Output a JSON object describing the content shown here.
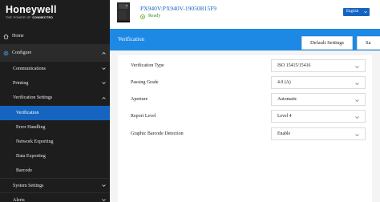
{
  "brand": {
    "name": "Honeywell",
    "tagline_prefix": "THE POWER OF",
    "tagline_bold": "CONNECTED"
  },
  "header": {
    "printer_name": "PX940V:PX940V-19050B15F9",
    "status": "Ready",
    "language": "English"
  },
  "sidebar": {
    "home": "Home",
    "configure": "Configure",
    "items": [
      {
        "label": "Communications"
      },
      {
        "label": "Printing"
      },
      {
        "label": "Verification Settings"
      },
      {
        "label": "Verification"
      },
      {
        "label": "Error Handling"
      },
      {
        "label": "Network Exporting"
      },
      {
        "label": "Data Exporting"
      },
      {
        "label": "Barcode"
      },
      {
        "label": "System Settings"
      },
      {
        "label": "Alerts"
      }
    ]
  },
  "page": {
    "title": "Verification",
    "default_button": "Default Settings",
    "save_button": "Sa"
  },
  "settings": [
    {
      "label": "Verification Type",
      "value": "ISO 15415/15416"
    },
    {
      "label": "Passing Grade",
      "value": "4.0 (A)"
    },
    {
      "label": "Aperture",
      "value": "Automatic"
    },
    {
      "label": "Report Level",
      "value": "Level 4"
    },
    {
      "label": "Graphic Barcode Detection",
      "value": "Enable"
    }
  ],
  "colors": {
    "accent": "#1e88e5",
    "active_nav": "#1565c0",
    "sidebar_bg": "#1d1d1d",
    "ready_green": "#7fb23f"
  }
}
